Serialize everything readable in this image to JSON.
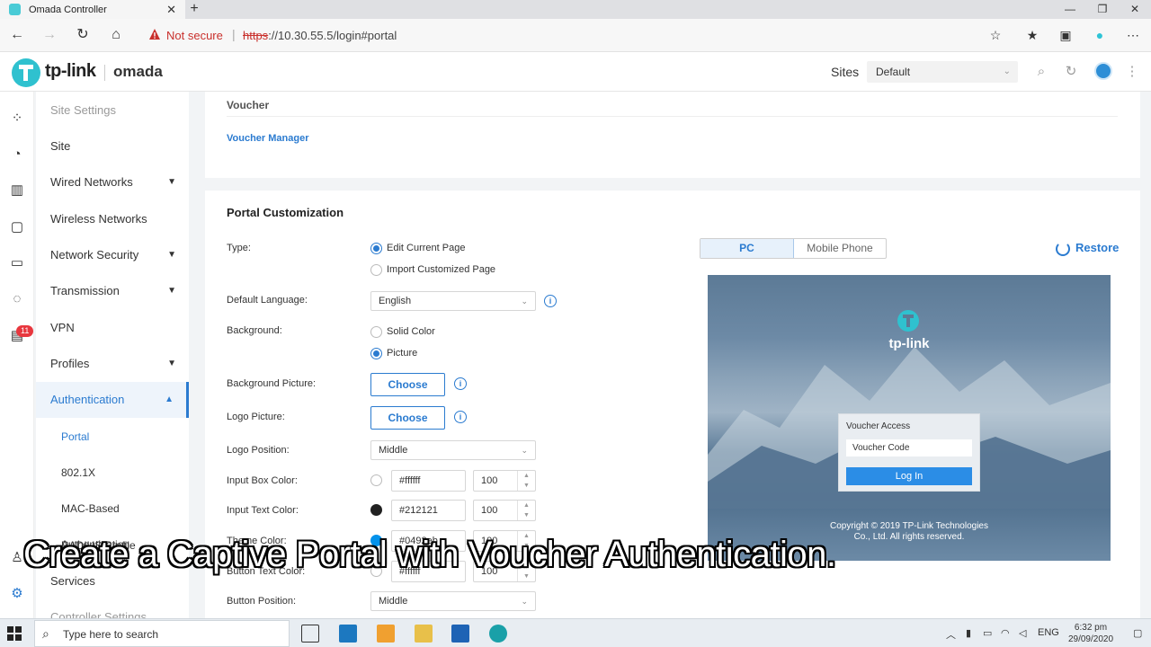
{
  "browser": {
    "tab_title": "Omada Controller",
    "not_secure": "Not secure",
    "url_scheme": "https",
    "url_rest": "://10.30.55.5/login#portal"
  },
  "header": {
    "logo": "tp-link",
    "product": "omada",
    "sites_label": "Sites",
    "site_value": "Default"
  },
  "sidebar": {
    "items": [
      {
        "label": "Site Settings"
      },
      {
        "label": "Site"
      },
      {
        "label": "Wired Networks"
      },
      {
        "label": "Wireless Networks"
      },
      {
        "label": "Network Security"
      },
      {
        "label": "Transmission"
      },
      {
        "label": "VPN"
      },
      {
        "label": "Profiles"
      },
      {
        "label": "Authentication"
      },
      {
        "label": "Portal"
      },
      {
        "label": "802.1X"
      },
      {
        "label": "MAC-Based Authentication"
      },
      {
        "label": "RADIUS Profile"
      },
      {
        "label": "Services"
      },
      {
        "label": "Controller Settings"
      }
    ],
    "badge": "11"
  },
  "voucher": {
    "title": "Voucher",
    "link": "Voucher Manager"
  },
  "portal": {
    "title": "Portal Customization",
    "type_label": "Type:",
    "type_options": [
      "Edit Current Page",
      "Import Customized Page"
    ],
    "language_label": "Default Language:",
    "language_value": "English",
    "background_label": "Background:",
    "background_options": [
      "Solid Color",
      "Picture"
    ],
    "bg_picture_label": "Background Picture:",
    "logo_picture_label": "Logo Picture:",
    "choose_label": "Choose",
    "logo_position_label": "Logo Position:",
    "logo_position_value": "Middle",
    "input_box_color_label": "Input Box Color:",
    "input_box_color": "#ffffff",
    "input_box_opacity": "100",
    "input_text_color_label": "Input Text Color:",
    "input_text_color": "#212121",
    "input_text_opacity": "100",
    "theme_color_label": "Theme Color:",
    "theme_color": "#0492eb",
    "theme_opacity": "100",
    "button_text_color_label": "Button Text Color:",
    "button_text_color": "#ffffff",
    "button_text_opacity": "100",
    "button_position_label": "Button Position:",
    "button_position_value": "Middle"
  },
  "preview": {
    "tab_pc": "PC",
    "tab_mobile": "Mobile Phone",
    "restore": "Restore",
    "logo_text": "tp-link",
    "box_title": "Voucher Access",
    "input_placeholder": "Voucher Code",
    "login_button": "Log In",
    "copyright": "Copyright © 2019 TP-Link Technologies Co., Ltd. All rights reserved."
  },
  "caption": "Create a Captive Portal with Voucher Authentication.",
  "taskbar": {
    "search_placeholder": "Type here to search",
    "lang": "ENG",
    "time": "6:32 pm",
    "date": "29/09/2020"
  },
  "colors": {
    "accent": "#2b7bd0",
    "theme": "#0492eb",
    "input_text": "#212121"
  }
}
